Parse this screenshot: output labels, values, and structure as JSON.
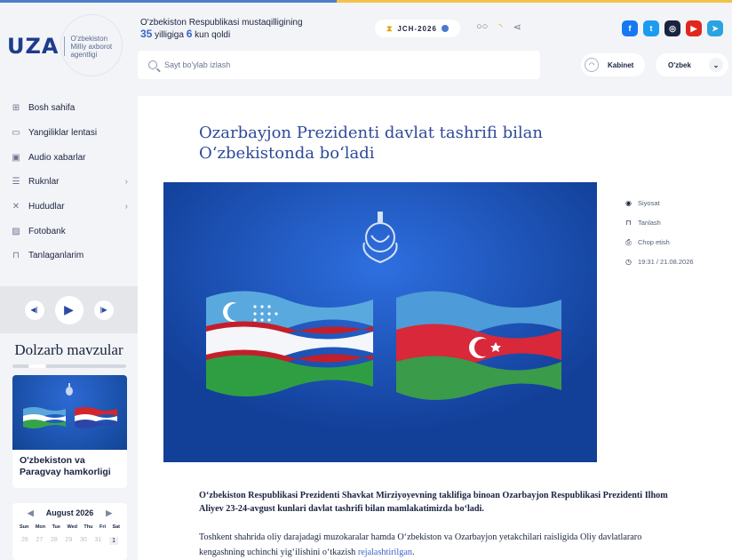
{
  "header": {
    "logo_text": "UZA",
    "logo_subtitle": "O'zbekiston Milliy axborot agentligi",
    "countdown_line1": "O'zbekiston Respublikasi mustaqilligining",
    "countdown_years": "35",
    "countdown_mid": " yilligiga ",
    "countdown_days": "6",
    "countdown_end": " kun qoldi",
    "jch_label": "JCH-2026",
    "search_placeholder": "Sayt bo'ylab izlash",
    "kabinet_label": "Kabinet",
    "language": "O'zbek",
    "socials": [
      {
        "name": "facebook",
        "color": "#1877f2"
      },
      {
        "name": "twitter",
        "color": "#1d9bf0"
      },
      {
        "name": "instagram",
        "color": "#1a2340"
      },
      {
        "name": "youtube",
        "color": "#e2261c"
      },
      {
        "name": "telegram",
        "color": "#2aa3e1"
      }
    ]
  },
  "sidebar": {
    "items": [
      {
        "label": "Bosh sahifa",
        "icon": "grid-icon"
      },
      {
        "label": "Yangiliklar lentasi",
        "icon": "feed-icon"
      },
      {
        "label": "Audio xabarlar",
        "icon": "audio-icon"
      },
      {
        "label": "Ruknlar",
        "icon": "list-icon",
        "has_arrow": true
      },
      {
        "label": "Hududlar",
        "icon": "regions-icon",
        "has_arrow": true
      },
      {
        "label": "Fotobank",
        "icon": "photo-icon"
      },
      {
        "label": "Tanlaganlarim",
        "icon": "bookmark-icon"
      }
    ],
    "dolzarb_title": "Dolzarb mavzular",
    "topic_card_title": "O'zbekiston va Paragvay hamkorligi",
    "calendar": {
      "month": "August 2026",
      "days": [
        "Sun",
        "Mon",
        "Tue",
        "Wed",
        "Thu",
        "Fri",
        "Sat"
      ],
      "dates": [
        "26",
        "27",
        "28",
        "29",
        "30",
        "31",
        "1"
      ]
    }
  },
  "article": {
    "title": "Ozarbayjon Prezidenti davlat tashrifi bilan O‘zbekistonda bo‘ladi",
    "meta": {
      "category": "Siyosat",
      "bookmark": "Tanlash",
      "print": "Chop etish",
      "datetime": "19:31 / 21.08.2026"
    },
    "lead": "O‘zbekiston Respublikasi Prezidenti Shavkat Mirziyoyevning taklifiga binoan Ozarbayjon Respublikasi Prezidenti Ilhom Aliyev 23-24-avgust kunlari davlat tashrifi bilan mamlakatimizda bo‘ladi.",
    "body_start": "Toshkent shahrida oliy darajadagi muzokaralar hamda O‘zbekiston va Ozarbayjon yetakchilari raisligida Oliy davlatlararo kengashning uchinchi yig‘ilishini o‘tkazish ",
    "body_link": "rejalashtirilgan",
    "body_end": "."
  }
}
